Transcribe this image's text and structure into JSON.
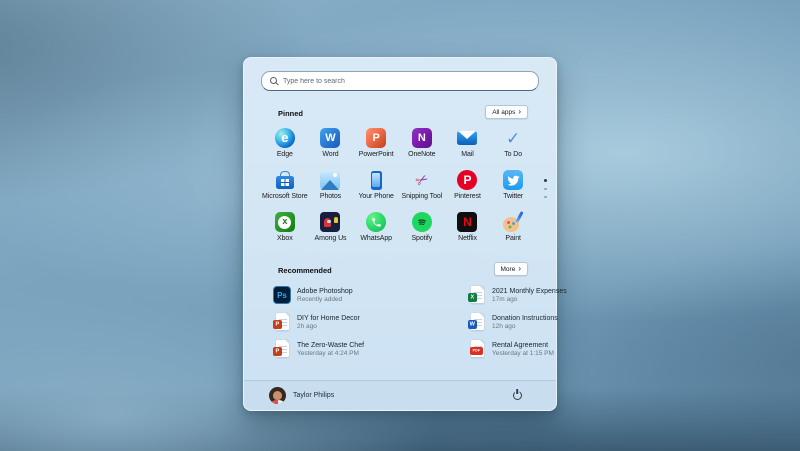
{
  "colors": {
    "accent_blue": "#0b5fae",
    "panel_bg": "#d5e7f6",
    "edge_blue": "#1173cf",
    "word_blue": "#185abd",
    "powerpoint_orange": "#c43e1c",
    "onenote_purple": "#7719aa",
    "pinterest_red": "#e60023",
    "twitter_blue": "#1d9bf0",
    "xbox_green": "#107c10",
    "whatsapp_green": "#25d366",
    "spotify_green": "#1ed760",
    "netflix_red": "#e50914",
    "excel_green": "#107c41",
    "pdf_red": "#d93025",
    "photoshop_blue": "#31a8ff"
  },
  "start_menu": {
    "search": {
      "placeholder": "Type here to search",
      "icon": "search-icon"
    },
    "pinned": {
      "title": "Pinned",
      "all_apps_button": {
        "label": "All apps",
        "chevron": "›"
      },
      "apps": [
        {
          "label": "Edge",
          "icon": "edge-icon",
          "glyph": "e"
        },
        {
          "label": "Word",
          "icon": "word-icon",
          "glyph": "W"
        },
        {
          "label": "PowerPoint",
          "icon": "powerpoint-icon",
          "glyph": "P"
        },
        {
          "label": "OneNote",
          "icon": "onenote-icon",
          "glyph": "N"
        },
        {
          "label": "Mail",
          "icon": "mail-icon",
          "glyph": ""
        },
        {
          "label": "To Do",
          "icon": "to-do-icon",
          "glyph": "✓"
        },
        {
          "label": "Microsoft Store",
          "icon": "microsoft-store-icon",
          "glyph": ""
        },
        {
          "label": "Photos",
          "icon": "photos-icon",
          "glyph": ""
        },
        {
          "label": "Your Phone",
          "icon": "your-phone-icon",
          "glyph": ""
        },
        {
          "label": "Snipping Tool",
          "icon": "snipping-tool-icon",
          "glyph": "✂"
        },
        {
          "label": "Pinterest",
          "icon": "pinterest-icon",
          "glyph": "P"
        },
        {
          "label": "Twitter",
          "icon": "twitter-icon",
          "glyph": ""
        },
        {
          "label": "Xbox",
          "icon": "xbox-icon",
          "glyph": "x"
        },
        {
          "label": "Among Us",
          "icon": "among-us-icon",
          "glyph": ""
        },
        {
          "label": "WhatsApp",
          "icon": "whatsapp-icon",
          "glyph": ""
        },
        {
          "label": "Spotify",
          "icon": "spotify-icon",
          "glyph": ""
        },
        {
          "label": "Netflix",
          "icon": "netflix-icon",
          "glyph": "N"
        },
        {
          "label": "Paint",
          "icon": "paint-icon",
          "glyph": ""
        }
      ],
      "page_indicator": {
        "pages": 3,
        "active_page": 1
      }
    },
    "recommended": {
      "title": "Recommended",
      "more_button": {
        "label": "More",
        "chevron": "›"
      },
      "items": [
        {
          "title": "Adobe Photoshop",
          "subtitle": "Recently added",
          "icon": "photoshop-icon",
          "badge": "Ps"
        },
        {
          "title": "2021 Monthly Expenses",
          "subtitle": "17m ago",
          "icon": "excel-file-icon",
          "badge": "X"
        },
        {
          "title": "DIY for Home Decor",
          "subtitle": "2h ago",
          "icon": "powerpoint-file-icon",
          "badge": "P"
        },
        {
          "title": "Donation Instructions",
          "subtitle": "12h ago",
          "icon": "word-file-icon",
          "badge": "W"
        },
        {
          "title": "The Zero-Waste Chef",
          "subtitle": "Yesterday at 4:24 PM",
          "icon": "powerpoint-file-icon",
          "badge": "P"
        },
        {
          "title": "Rental Agreement",
          "subtitle": "Yesterday at 1:15 PM",
          "icon": "pdf-file-icon",
          "badge": "PDF"
        }
      ]
    },
    "user": {
      "name": "Taylor Philips"
    },
    "power_button": {
      "icon": "power-icon"
    }
  }
}
